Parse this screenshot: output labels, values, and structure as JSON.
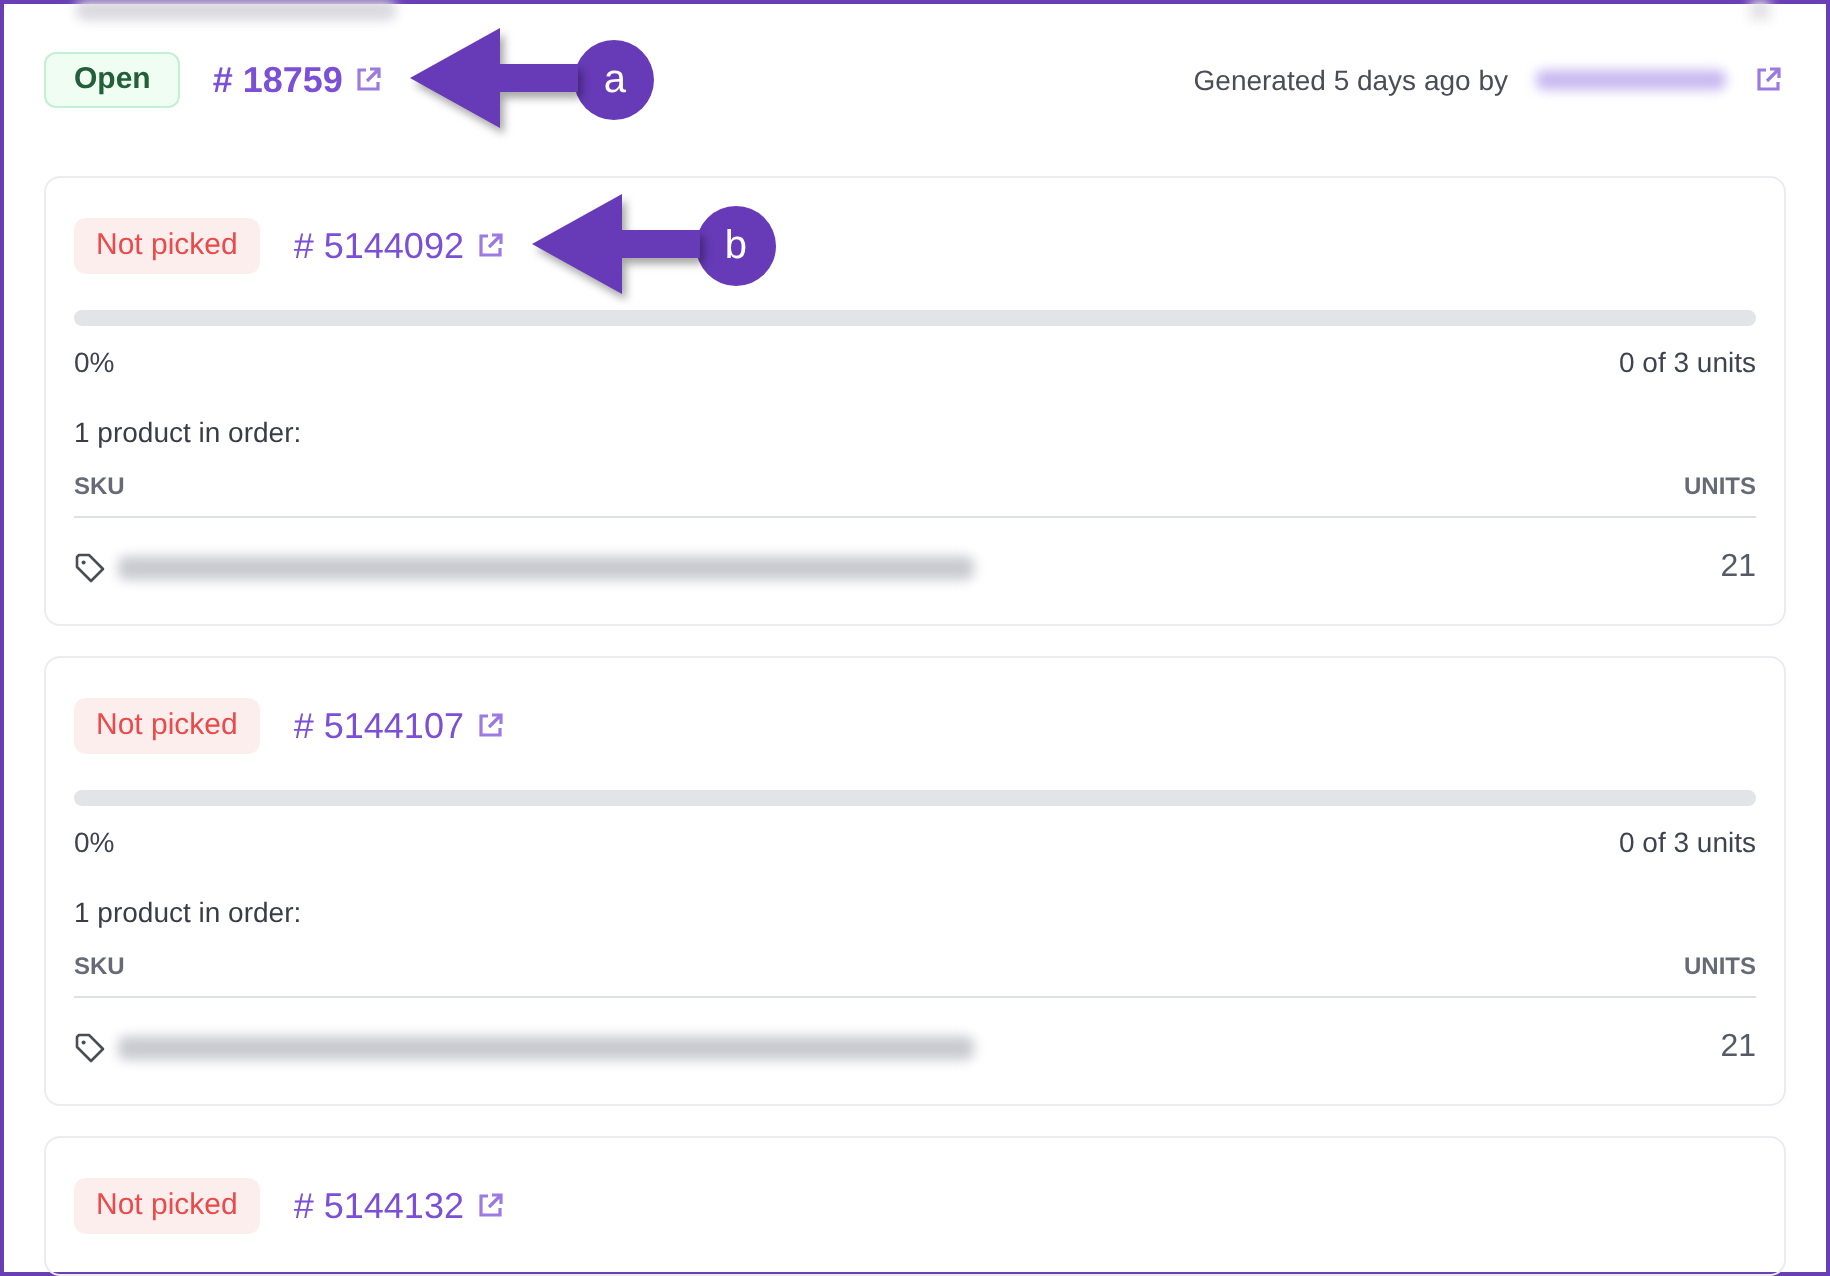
{
  "header": {
    "status": {
      "label": "Open",
      "kind": "open"
    },
    "order_link": "# 18759",
    "callout": "a",
    "generated": "Generated 5 days ago by"
  },
  "shipments": [
    {
      "status": {
        "label": "Not picked",
        "kind": "not_picked"
      },
      "order_link": "# 5144092",
      "callout": "b",
      "level": 0,
      "percent": "0%",
      "units_summary": "0 of 3 units",
      "products_heading": "1 product in order:",
      "columns": [
        "SKU",
        "UNITS"
      ],
      "rows": [
        {
          "units": "21"
        }
      ]
    },
    {
      "status": {
        "label": "Not picked",
        "kind": "not_picked"
      },
      "order_link": "# 5144107",
      "level": 0,
      "percent": "0%",
      "units_summary": "0 of 3 units",
      "products_heading": "1 product in order:",
      "columns": [
        "SKU",
        "UNITS"
      ],
      "rows": [
        {
          "units": "21"
        }
      ]
    },
    {
      "status": {
        "label": "Not picked",
        "kind": "not_picked"
      },
      "order_link": "# 5144132"
    }
  ]
}
